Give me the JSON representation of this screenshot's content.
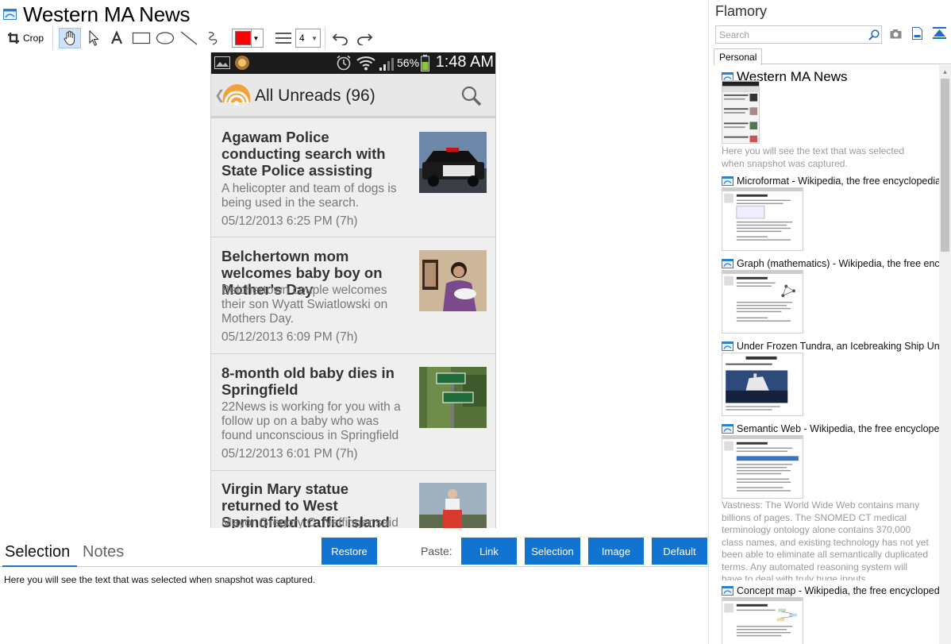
{
  "editor": {
    "title": "Western MA News",
    "toolbar": {
      "crop_label": "Crop",
      "line_width_value": "4",
      "color": "#ff0000"
    }
  },
  "phone": {
    "status_bar": {
      "battery_pct": "56%",
      "time": "1:48 AM"
    },
    "header_title": "All Unreads (96)",
    "items": [
      {
        "headline": "Agawam Police conducting search with State Police assisting",
        "summary": "A helicopter and team of dogs is being used in the search.",
        "date": "05/12/2013 6:25 PM (7h)"
      },
      {
        "headline": "Belchertown mom welcomes baby boy on Mother's Day",
        "summary": "Belchertown couple welcomes their son Wyatt Swiatlowski on Mothers Day.",
        "date": "05/12/2013 6:09 PM (7h)"
      },
      {
        "headline": "8-month old baby dies in Springfield",
        "summary": "22News is working for you with a follow up on a baby who was found unconscious in Springfield",
        "date": "05/12/2013 6:01 PM (7h)"
      },
      {
        "headline": "Virgin Mary statue returned to West Springfield traffic island",
        "summary": "Mayor Gregory C. Neffinger said",
        "date": ""
      }
    ]
  },
  "bottom": {
    "tabs": [
      "Selection",
      "Notes"
    ],
    "restore_label": "Restore",
    "paste_label": "Paste:",
    "paste_buttons": [
      "Link",
      "Selection",
      "Image",
      "Default"
    ],
    "notes_text": "Here you will see the text that was selected when snapshot was captured."
  },
  "panel": {
    "title": "Flamory",
    "search_placeholder": "Search",
    "tab_personal": "Personal",
    "snapshots": [
      {
        "title": "Western MA News",
        "text": "Here you will see the text that was selected when snapshot was captured."
      },
      {
        "title": "Microformat - Wikipedia, the free encyclopedia",
        "text": ""
      },
      {
        "title": "Graph (mathematics) - Wikipedia, the free ency",
        "text": ""
      },
      {
        "title": "Under Frozen Tundra, an Icebreaking Ship Unco",
        "text": ""
      },
      {
        "title": "Semantic Web - Wikipedia, the free encycloped",
        "text": "Vastness: The World Wide Web contains many billions of pages. The SNOMED CT medical terminology ontology alone contains 370,000 class names, and existing technology has not yet been able to eliminate all semantically duplicated terms. Any automated reasoning system will have to deal with truly huge inputs."
      },
      {
        "title": "Concept map - Wikipedia, the free encyclopedia",
        "text": ""
      }
    ]
  }
}
